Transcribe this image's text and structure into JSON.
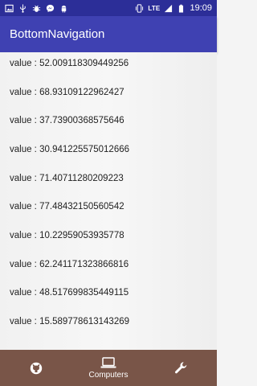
{
  "status_bar": {
    "time": "19:09",
    "network": "LTE",
    "icons": [
      "image-icon",
      "usb-icon",
      "bug-icon",
      "messenger-icon",
      "android-icon",
      "vibrate-icon",
      "signal-icon",
      "battery-icon"
    ]
  },
  "app_bar": {
    "title": "BottomNavigation"
  },
  "list": {
    "items": [
      "value : 52.009118309449256",
      "value : 68.93109122962427",
      "value : 37.73900368575646",
      "value : 30.941225575012666",
      "value : 71.40711280209223",
      "value : 77.48432150560542",
      "value : 10.22959053935778",
      "value : 62.241171323866816",
      "value : 48.517699835449115",
      "value : 15.589778613143269"
    ]
  },
  "bottom_nav": {
    "tabs": [
      {
        "icon": "github-icon",
        "label": ""
      },
      {
        "icon": "laptop-icon",
        "label": "Computers"
      },
      {
        "icon": "wrench-icon",
        "label": ""
      }
    ],
    "background": "#795548"
  },
  "colors": {
    "status_bar": "#2c2e98",
    "app_bar": "#3f41b2",
    "list_bg": "#f4f4f4"
  }
}
